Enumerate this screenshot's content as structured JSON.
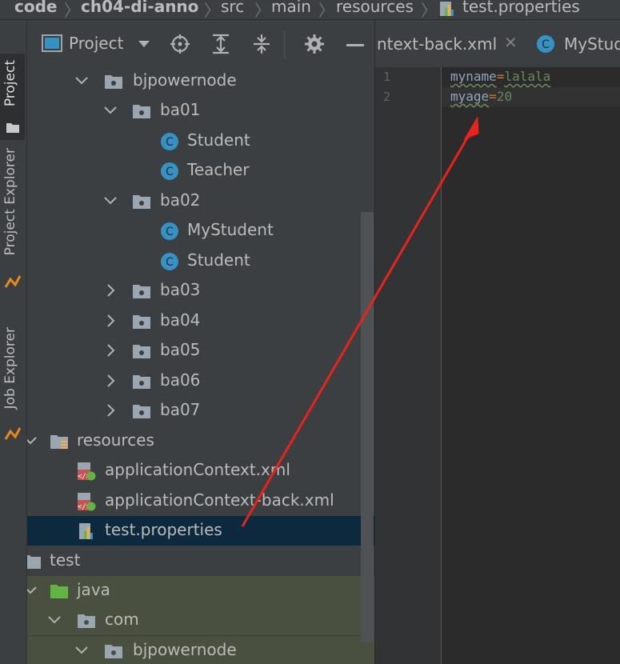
{
  "breadcrumb": [
    "code",
    "ch04-di-anno",
    "src",
    "main",
    "resources",
    "test.properties"
  ],
  "left_strip": {
    "project": "Project",
    "project_explorer": "Project Explorer",
    "job_explorer": "Job Explorer"
  },
  "project_panel": {
    "title": "Project",
    "toolbar_icons": [
      "locate-icon",
      "expand-all-icon",
      "collapse-all-icon",
      "settings-icon",
      "hide-icon"
    ]
  },
  "tree": [
    {
      "label": "bjpowernode",
      "type": "package",
      "expanded": true
    },
    {
      "label": "ba01",
      "type": "package",
      "expanded": true
    },
    {
      "label": "Student",
      "type": "class"
    },
    {
      "label": "Teacher",
      "type": "class"
    },
    {
      "label": "ba02",
      "type": "package",
      "expanded": true
    },
    {
      "label": "MyStudent",
      "type": "class"
    },
    {
      "label": "Student",
      "type": "class"
    },
    {
      "label": "ba03",
      "type": "package",
      "expanded": false
    },
    {
      "label": "ba04",
      "type": "package",
      "expanded": false
    },
    {
      "label": "ba05",
      "type": "package",
      "expanded": false
    },
    {
      "label": "ba06",
      "type": "package",
      "expanded": false
    },
    {
      "label": "ba07",
      "type": "package",
      "expanded": false
    },
    {
      "label": "resources",
      "type": "resources-folder",
      "expanded": true
    },
    {
      "label": "applicationContext.xml",
      "type": "spring-xml"
    },
    {
      "label": "applicationContext-back.xml",
      "type": "spring-xml"
    },
    {
      "label": "test.properties",
      "type": "properties",
      "selected": true
    },
    {
      "label": "test",
      "type": "folder"
    },
    {
      "label": "java",
      "type": "source-folder",
      "expanded": true
    },
    {
      "label": "com",
      "type": "package",
      "expanded": true
    },
    {
      "label": "bjpowernode",
      "type": "package",
      "expanded": true
    }
  ],
  "editor_tabs": [
    {
      "label": "ntext-back.xml",
      "closable": true
    },
    {
      "label": "MyStud"
    }
  ],
  "editor": {
    "lines": [
      {
        "number": "1",
        "key": "myname",
        "sep": "=",
        "value": "lalala"
      },
      {
        "number": "2",
        "key": "myage",
        "sep": "=",
        "value": "20"
      }
    ]
  },
  "colors": {
    "selection": "#0d293e",
    "panel": "#3c3f41",
    "editor_bg": "#2b2b2b",
    "annotation_arrow": "#e8231d",
    "class_icon": "#3592c4"
  }
}
